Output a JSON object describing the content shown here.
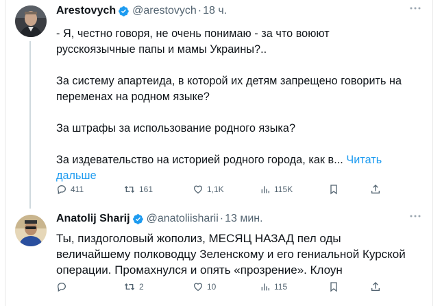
{
  "tweet1": {
    "name": "Arestovych",
    "handle": "@arestovych",
    "separator": "·",
    "time": "18 ч.",
    "text": [
      "- Я, честно говоря, не очень понимаю - за что воюют",
      "русскоязычные папы и мамы Украины?..",
      "За систему апартеида, в которой их детям запрещено говорить на",
      "переменах на родном языке?",
      "За штрафы за использование родного языка?",
      "За издевательство на историей родного города, как в..."
    ],
    "read_more": [
      " Читать",
      "дальше"
    ],
    "actions": {
      "replies": "411",
      "reposts": "161",
      "likes": "1,1K",
      "views": "115K"
    },
    "icons": [
      "verified-badge-icon",
      "more-icon",
      "reply-icon",
      "repost-icon",
      "like-icon",
      "views-icon",
      "bookmark-icon",
      "share-icon"
    ]
  },
  "tweet2": {
    "name": "Anatolij Sharij",
    "handle": "@anatoliisharii",
    "separator": "·",
    "time": "13 мин.",
    "text": [
      "Ты, пиздоголовый жополиз, МЕСЯЦ НАЗАД пел оды",
      "величайшему полководцу Зеленскому и его гениальной Курской",
      "операции. Промахнулся и опять «прозрение». Клоун"
    ],
    "actions": {
      "replies": "",
      "reposts": "2",
      "likes": "10",
      "views": "115"
    }
  },
  "colors": {
    "text": "#0f1419",
    "secondary": "#536471",
    "accent": "#1d9bf0",
    "thread_line": "#cfd9de"
  }
}
